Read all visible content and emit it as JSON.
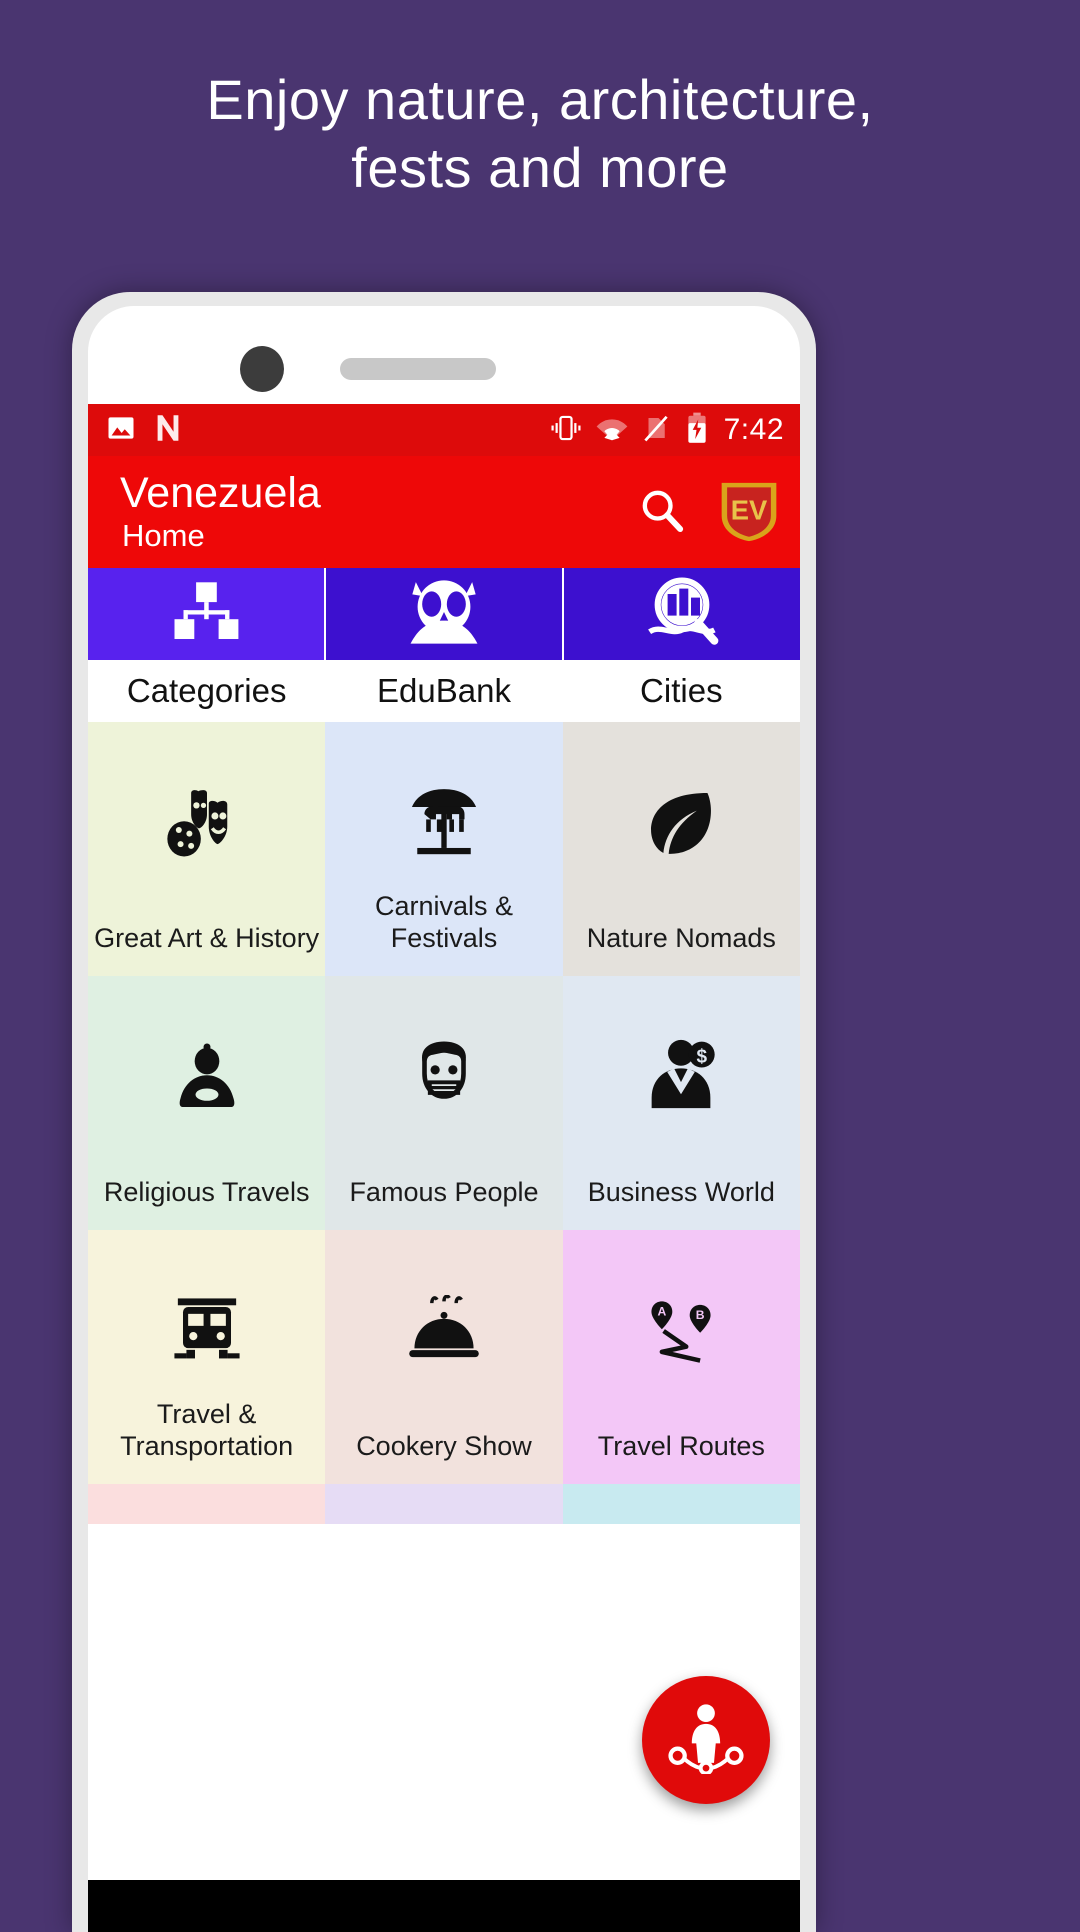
{
  "promo": {
    "headline_line1": "Enjoy nature, architecture,",
    "headline_line2": "fests and more",
    "background_color": "#4a3570"
  },
  "status_bar": {
    "time": "7:42",
    "icons": [
      "photo-icon",
      "n-logo-icon",
      "vibrate-icon",
      "wifi-icon",
      "no-sim-icon",
      "battery-charging-icon"
    ],
    "background_color": "#dd0b0b"
  },
  "app_bar": {
    "title": "Venezuela",
    "subtitle": "Home",
    "search_label": "search-icon",
    "logo_label": "EV",
    "background_color": "#ee0808",
    "logo_color": "#d9a41b"
  },
  "tabs": [
    {
      "label": "Categories",
      "icon": "hierarchy-icon",
      "active": true
    },
    {
      "label": "EduBank",
      "icon": "owl-icon",
      "active": false
    },
    {
      "label": "Cities",
      "icon": "city-search-icon",
      "active": false
    }
  ],
  "grid": {
    "tiles": [
      {
        "label": "Great Art & History",
        "icon": "theater-masks-icon",
        "bg": "#eef3d9"
      },
      {
        "label": "Carnivals & Festivals",
        "icon": "carousel-icon",
        "bg": "#dce6f8"
      },
      {
        "label": "Nature Nomads",
        "icon": "leaf-icon",
        "bg": "#e4e1dc"
      },
      {
        "label": "Religious Travels",
        "icon": "buddha-icon",
        "bg": "#dff0e2"
      },
      {
        "label": "Famous People",
        "icon": "famous-face-icon",
        "bg": "#e0e7e8"
      },
      {
        "label": "Business World",
        "icon": "businessman-icon",
        "bg": "#e0e8f2"
      },
      {
        "label": "Travel & Transportation",
        "icon": "train-icon",
        "bg": "#f7f3dc"
      },
      {
        "label": "Cookery Show",
        "icon": "food-cloche-icon",
        "bg": "#f2e2dd"
      },
      {
        "label": "Travel Routes",
        "icon": "route-map-icon",
        "bg": "#f3c7f7"
      }
    ],
    "partial_row_colors": [
      "#fbdede",
      "#e6dcf5",
      "#c8eaf0"
    ]
  },
  "fab": {
    "icon": "people-network-icon",
    "color": "#e00a0a"
  }
}
